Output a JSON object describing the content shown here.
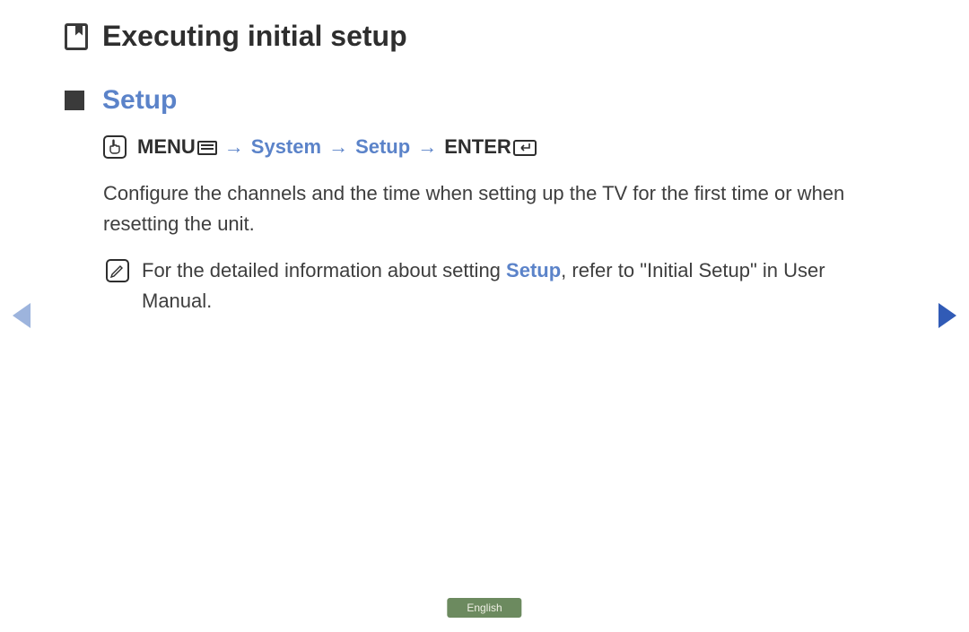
{
  "page": {
    "title": "Executing initial setup"
  },
  "section": {
    "title": "Setup"
  },
  "navpath": {
    "menu": "MENU",
    "arrow1": "→",
    "system": "System",
    "arrow2": "→",
    "setup": "Setup",
    "arrow3": "→",
    "enter": "ENTER"
  },
  "body": {
    "paragraph1": "Configure the channels and the time when setting up the TV for the first time or when resetting the unit."
  },
  "note": {
    "prefix": "For the detailed information about setting ",
    "highlight": "Setup",
    "suffix": ", refer to \"Initial Setup\" in User Manual."
  },
  "footer": {
    "language": "English"
  }
}
